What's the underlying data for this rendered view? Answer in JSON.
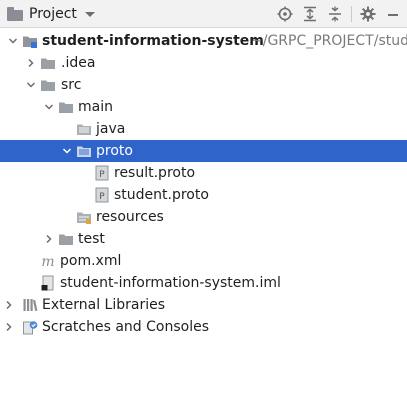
{
  "header": {
    "view_label": "Project",
    "icons": [
      "project-icon",
      "locate-icon",
      "expand-all-icon",
      "collapse-all-icon",
      "settings-icon",
      "hide-icon"
    ]
  },
  "tree": {
    "root": {
      "label": "student-information-system",
      "path": "~/GRPC_PROJECT/stud"
    },
    "idea": {
      "label": ".idea"
    },
    "src": {
      "label": "src"
    },
    "main": {
      "label": "main"
    },
    "java": {
      "label": "java"
    },
    "proto": {
      "label": "proto"
    },
    "result_proto": {
      "label": "result.proto"
    },
    "student_proto": {
      "label": "student.proto"
    },
    "resources": {
      "label": "resources"
    },
    "test": {
      "label": "test"
    },
    "pom": {
      "label": "pom.xml"
    },
    "iml": {
      "label": "student-information-system.iml"
    },
    "external_libraries": {
      "label": "External Libraries"
    },
    "scratches": {
      "label": "Scratches and Consoles"
    }
  },
  "colors": {
    "selection": "#2f65ca",
    "folder": "#9aa0a6",
    "header_bg": "#f2f2f2"
  }
}
